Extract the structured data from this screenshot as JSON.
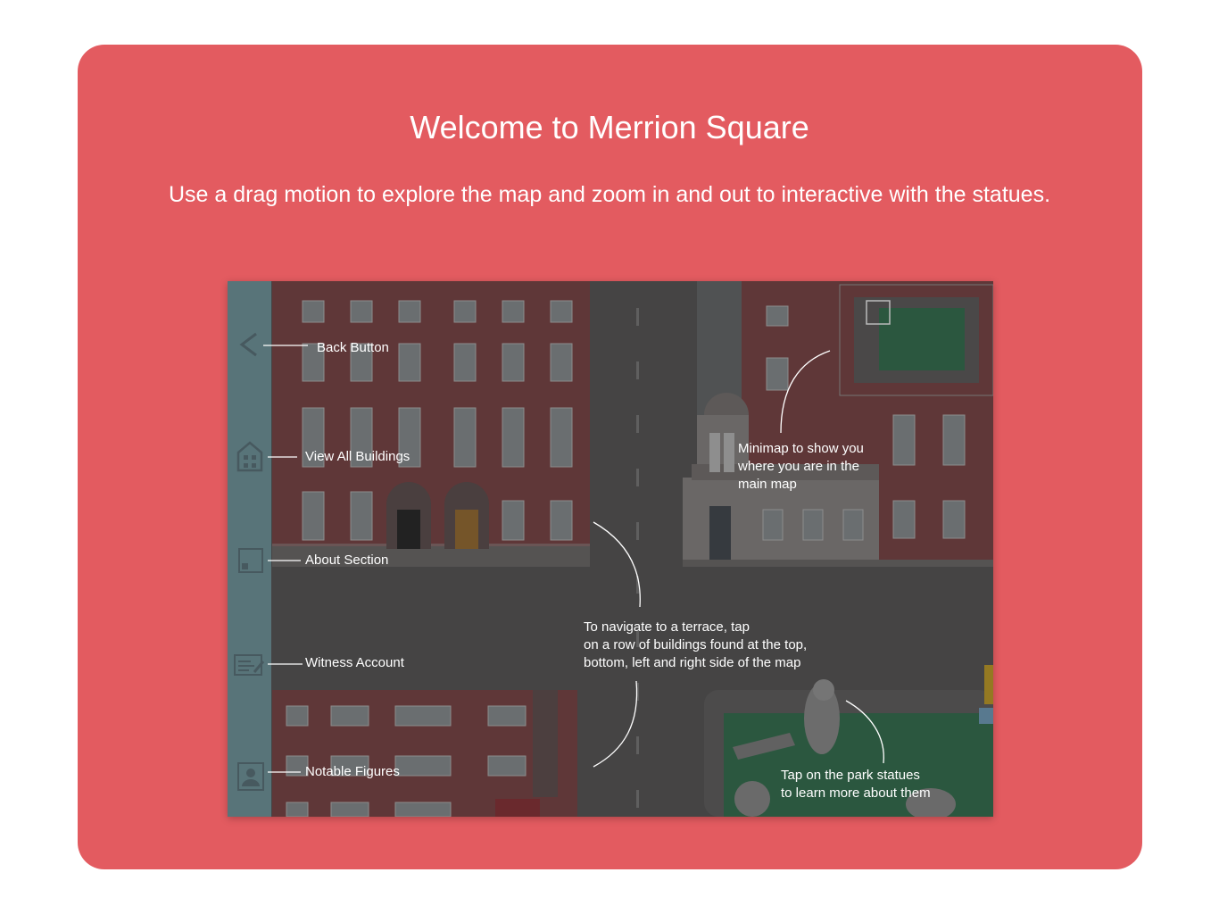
{
  "heading": {
    "title": "Welcome to Merrion Square",
    "subtitle": "Use a drag motion to explore the map and zoom in and out to interactive with the statues."
  },
  "colors": {
    "card": "#E35B60",
    "sidebar": "#6F98A0",
    "road": "#535151",
    "brick": "#7A3E40",
    "park": "#2D6E4A"
  },
  "sidebar": {
    "items": [
      {
        "icon": "chevron-left-icon",
        "label": "Back Button"
      },
      {
        "icon": "house-icon",
        "label": "View All Buildings"
      },
      {
        "icon": "about-icon",
        "label": "About Section"
      },
      {
        "icon": "witness-letter-icon",
        "label": "Witness Account"
      },
      {
        "icon": "portrait-icon",
        "label": "Notable Figures"
      }
    ]
  },
  "annotations": {
    "minimap": "Minimap to show you\nwhere you are in the\nmain map",
    "navigate": "To navigate to a terrace, tap\non a row of buildings found at the top,\nbottom, left and right side of the map",
    "statues": "Tap on the park statues\nto learn more about them"
  }
}
